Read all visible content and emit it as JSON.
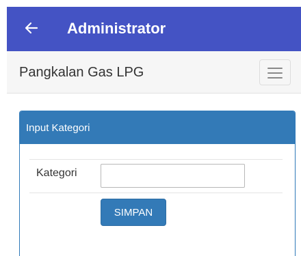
{
  "appbar": {
    "title": "Administrator",
    "back_icon": "arrow-left-icon",
    "background": "#4453c4"
  },
  "navbar": {
    "brand": "Pangkalan Gas LPG",
    "menu_icon": "hamburger-menu-icon"
  },
  "panel": {
    "heading": "Input Kategori",
    "heading_color": "#337ab7",
    "form": {
      "label": "Kategori",
      "input_value": "",
      "submit_label": "SIMPAN"
    }
  }
}
